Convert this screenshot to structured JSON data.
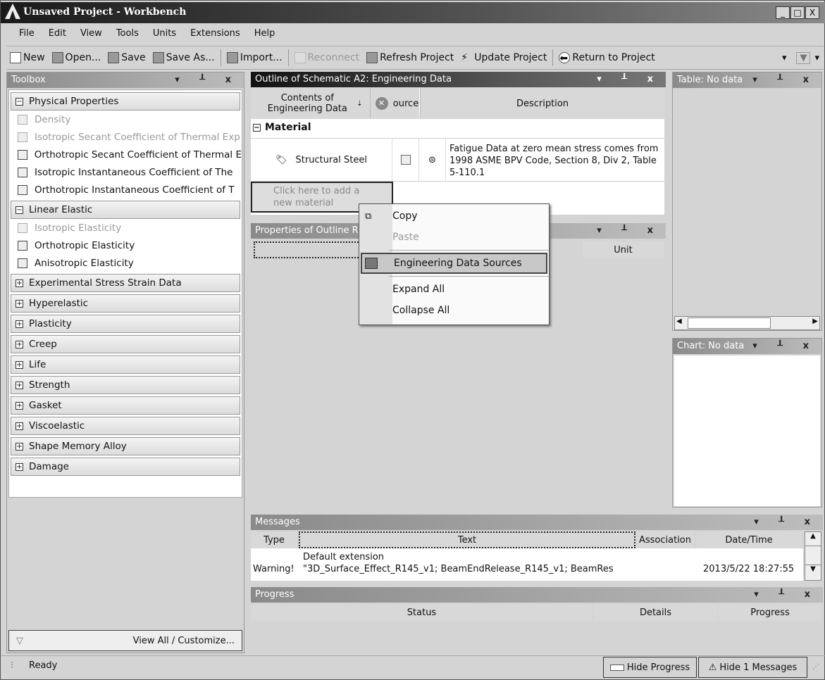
{
  "window": {
    "title": "Unsaved Project - Workbench",
    "min": "_",
    "max": "□",
    "close": "X"
  },
  "menu": [
    "File",
    "Edit",
    "View",
    "Tools",
    "Units",
    "Extensions",
    "Help"
  ],
  "toolbar": {
    "new": "New",
    "open": "Open...",
    "save": "Save",
    "save_as": "Save As...",
    "import": "Import...",
    "reconnect": "Reconnect",
    "refresh": "Refresh Project",
    "update": "Update Project",
    "return": "Return to Project"
  },
  "toolbox": {
    "title": "Toolbox",
    "groups": [
      {
        "label": "Physical Properties",
        "expanded": true,
        "items": [
          {
            "label": "Density",
            "enabled": false
          },
          {
            "label": "Isotropic Secant Coefficient of Thermal Exp",
            "enabled": false
          },
          {
            "label": "Orthotropic Secant Coefficient of Thermal E",
            "enabled": true
          },
          {
            "label": "Isotropic Instantaneous Coefficient of The",
            "enabled": true
          },
          {
            "label": "Orthotropic Instantaneous Coefficient of T",
            "enabled": true
          }
        ]
      },
      {
        "label": "Linear Elastic",
        "expanded": true,
        "items": [
          {
            "label": "Isotropic Elasticity",
            "enabled": false
          },
          {
            "label": "Orthotropic Elasticity",
            "enabled": true
          },
          {
            "label": "Anisotropic Elasticity",
            "enabled": true
          }
        ]
      },
      {
        "label": "Experimental Stress Strain Data"
      },
      {
        "label": "Hyperelastic"
      },
      {
        "label": "Plasticity"
      },
      {
        "label": "Creep"
      },
      {
        "label": "Life"
      },
      {
        "label": "Strength"
      },
      {
        "label": "Gasket"
      },
      {
        "label": "Viscoelastic"
      },
      {
        "label": "Shape Memory Alloy"
      },
      {
        "label": "Damage"
      }
    ],
    "view_all": "View All / Customize..."
  },
  "outline": {
    "title": "Outline of Schematic A2: Engineering Data",
    "col_contents": "Contents of Engineering Data",
    "col_source": "ource",
    "col_description": "Description",
    "category": "Material",
    "material": "Structural Steel",
    "description": "Fatigue Data at zero mean stress comes from 1998 ASME BPV Code, Section 8, Div 2, Table 5-110.1",
    "add_placeholder": "Click here to add a new material"
  },
  "properties": {
    "title": "Properties of Outline R",
    "col_unit": "Unit"
  },
  "context_menu": [
    "Copy",
    "Paste",
    "Engineering Data Sources",
    "Expand All",
    "Collapse All"
  ],
  "table": {
    "title": "Table: No data"
  },
  "chart": {
    "title": "Chart: No data"
  },
  "messages": {
    "title": "Messages",
    "columns": [
      "Type",
      "Text",
      "Association",
      "Date/Time"
    ],
    "row": {
      "type": "Warning!",
      "text_line1": "Default extension",
      "text_line2": "\"3D_Surface_Effect_R145_v1; BeamEndRelease_R145_v1; BeamRes",
      "association": "",
      "datetime": "2013/5/22 18:27:55"
    }
  },
  "progress": {
    "title": "Progress",
    "columns": [
      "Status",
      "Details",
      "Progress"
    ]
  },
  "status": {
    "text": "Ready",
    "hide_progress": "Hide Progress",
    "hide_messages": "Hide 1 Messages"
  }
}
